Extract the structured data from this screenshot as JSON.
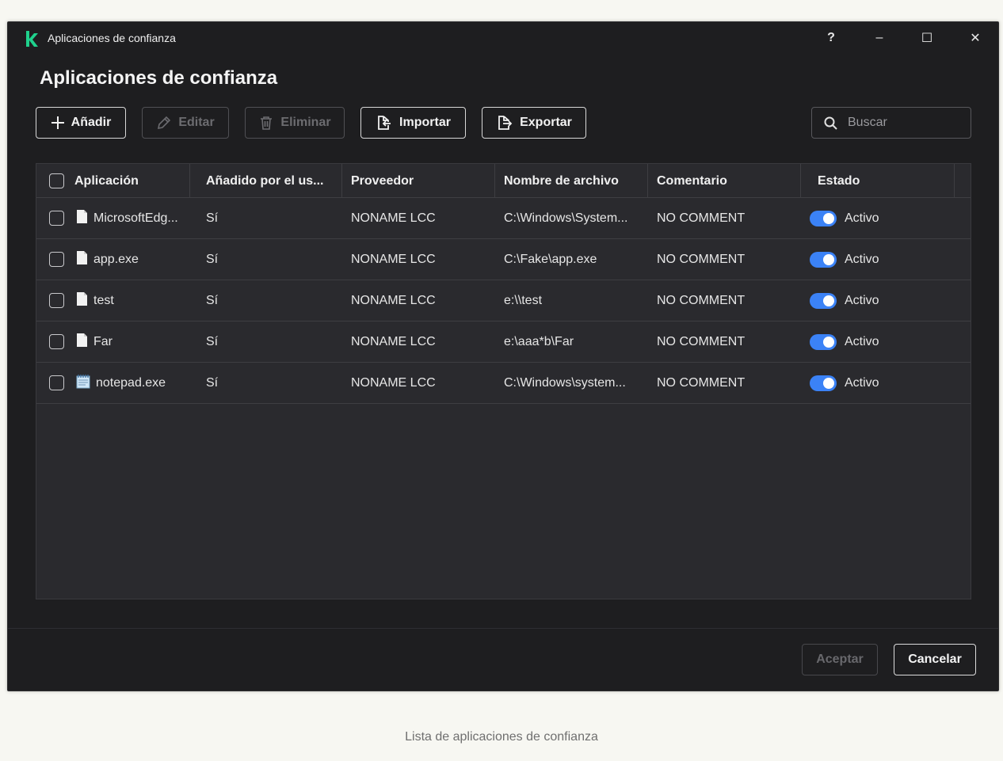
{
  "window": {
    "title": "Aplicaciones de confianza",
    "controls": {
      "help": "?",
      "minimize": "–",
      "maximize": "☐",
      "close": "✕"
    }
  },
  "page": {
    "title": "Aplicaciones de confianza"
  },
  "toolbar": {
    "add_label": "Añadir",
    "edit_label": "Editar",
    "delete_label": "Eliminar",
    "import_label": "Importar",
    "export_label": "Exportar",
    "search_placeholder": "Buscar"
  },
  "table": {
    "columns": [
      "Aplicación",
      "Añadido por el us...",
      "Proveedor",
      "Nombre de archivo",
      "Comentario",
      "Estado"
    ],
    "rows": [
      {
        "app": "MicrosoftEdg...",
        "added": "Sí",
        "vendor": "NONAME LCC",
        "file": "C:\\Windows\\System...",
        "comment": "NO COMMENT",
        "status": "Activo",
        "icon": "file-icon",
        "enabled": true
      },
      {
        "app": "app.exe",
        "added": "Sí",
        "vendor": "NONAME LCC",
        "file": "C:\\Fake\\app.exe",
        "comment": "NO COMMENT",
        "status": "Activo",
        "icon": "file-icon",
        "enabled": true
      },
      {
        "app": "test",
        "added": "Sí",
        "vendor": "NONAME LCC",
        "file": "e:\\\\test",
        "comment": "NO COMMENT",
        "status": "Activo",
        "icon": "file-icon",
        "enabled": true
      },
      {
        "app": "Far",
        "added": "Sí",
        "vendor": "NONAME LCC",
        "file": "e:\\aaa*b\\Far",
        "comment": "NO COMMENT",
        "status": "Activo",
        "icon": "file-icon",
        "enabled": true
      },
      {
        "app": "notepad.exe",
        "added": "Sí",
        "vendor": "NONAME LCC",
        "file": "C:\\Windows\\system...",
        "comment": "NO COMMENT",
        "status": "Activo",
        "icon": "notepad-icon",
        "enabled": true
      }
    ]
  },
  "footer": {
    "accept_label": "Aceptar",
    "cancel_label": "Cancelar"
  },
  "caption": "Lista de aplicaciones de confianza",
  "colors": {
    "window_bg": "#1e1e20",
    "grid_bg": "#2a2a2e",
    "toggle_on": "#3b82f6",
    "logo": "#1fd18c"
  }
}
